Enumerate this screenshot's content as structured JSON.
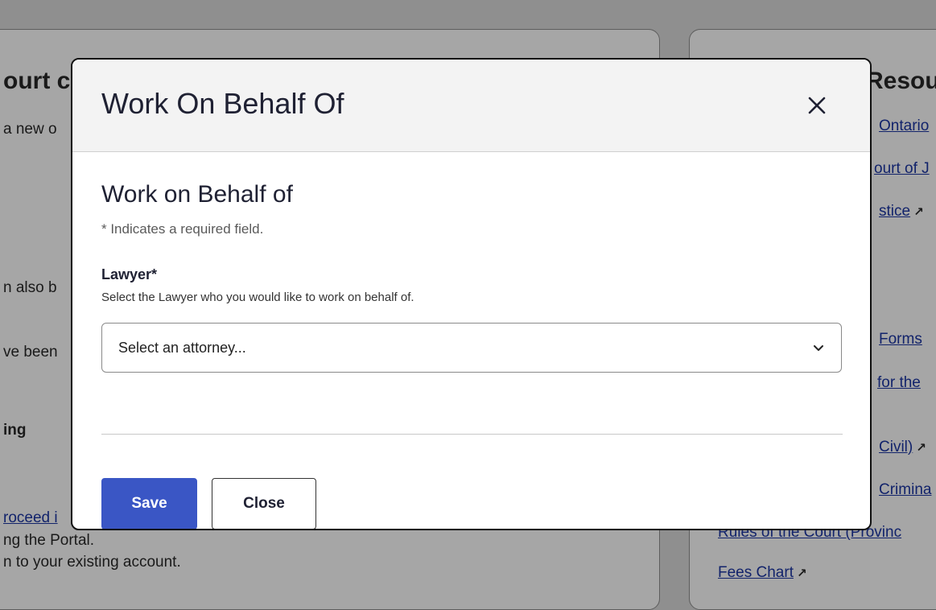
{
  "background": {
    "left_card": {
      "title_fragment": "ourt c",
      "line1": "a new o",
      "line2": "n also b",
      "line3": "ve been",
      "heading": "ing",
      "link_fragment": "roceed i",
      "line4": "ng the Portal.",
      "line5": "n to your existing account."
    },
    "right_card": {
      "title_fragment": "Resou",
      "links": [
        "Ontario",
        "ourt of J",
        "stice",
        "Forms",
        "for the",
        "Civil)",
        "Crimina",
        "Rules of the Court (Provinc",
        "Fees Chart"
      ]
    }
  },
  "modal": {
    "title": "Work On Behalf Of",
    "close_icon": "close-icon",
    "section_title": "Work on Behalf of",
    "required_note": "* Indicates a required field.",
    "lawyer_field": {
      "label": "Lawyer*",
      "help": "Select the Lawyer who you would like to work on behalf of.",
      "placeholder": "Select an attorney...",
      "icon": "chevron-down-icon"
    },
    "buttons": {
      "save": "Save",
      "close": "Close"
    }
  },
  "colors": {
    "overlay": "#8f8f8f",
    "primary": "#3a56c5",
    "link": "#12236b"
  }
}
